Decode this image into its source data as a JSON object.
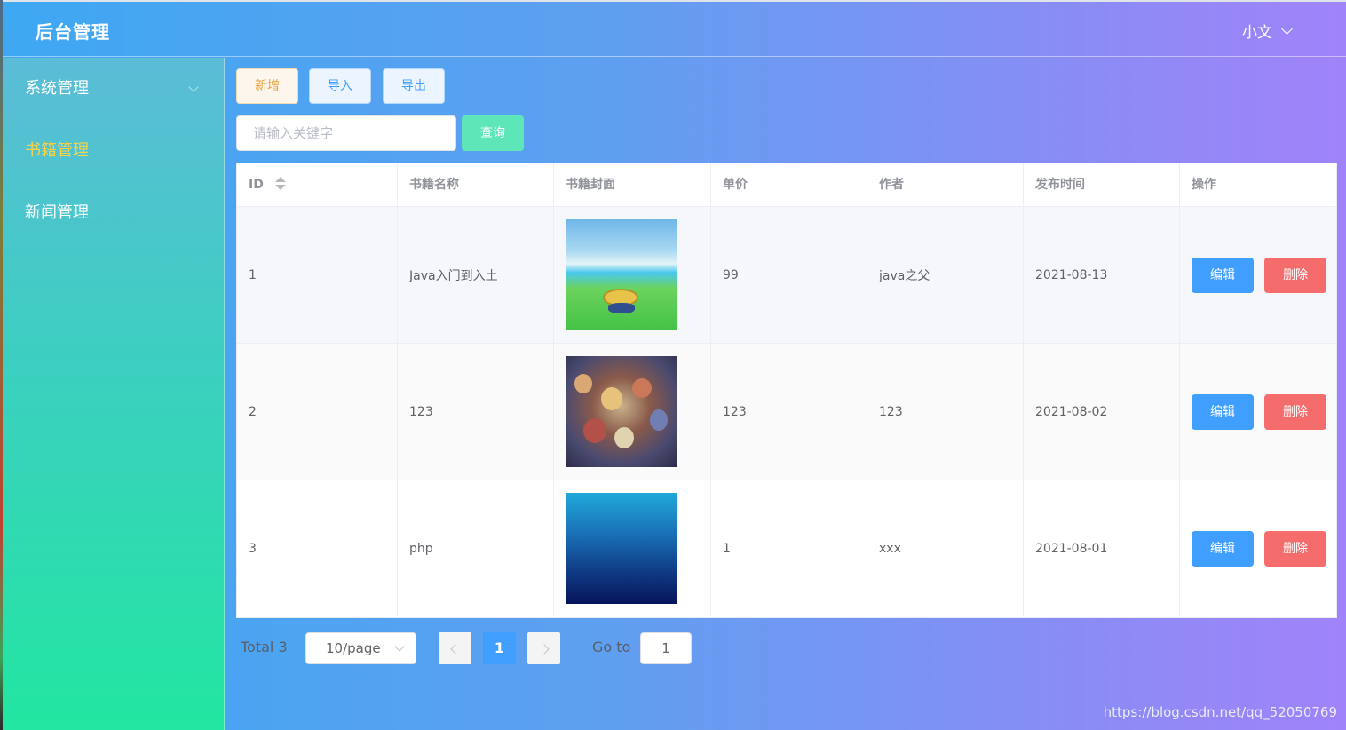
{
  "header": {
    "brand": "后台管理",
    "user": "小文"
  },
  "sidebar": {
    "items": [
      {
        "label": "系统管理",
        "has_submenu": true
      },
      {
        "label": "书籍管理",
        "active": true
      },
      {
        "label": "新闻管理"
      }
    ]
  },
  "toolbar": {
    "add_label": "新增",
    "import_label": "导入",
    "export_label": "导出"
  },
  "search": {
    "placeholder": "请输入关键字",
    "value": "",
    "query_label": "查询"
  },
  "table": {
    "columns": [
      "ID",
      "书籍名称",
      "书籍封面",
      "单价",
      "作者",
      "发布时间",
      "操作"
    ],
    "rows": [
      {
        "id": "1",
        "name": "Java入门到入土",
        "price": "99",
        "author": "java之父",
        "date": "2021-08-13",
        "edit": "编辑",
        "delete": "删除"
      },
      {
        "id": "2",
        "name": "123",
        "price": "123",
        "author": "123",
        "date": "2021-08-02",
        "edit": "编辑",
        "delete": "删除"
      },
      {
        "id": "3",
        "name": "php",
        "price": "1",
        "author": "xxx",
        "date": "2021-08-01",
        "edit": "编辑",
        "delete": "删除"
      }
    ]
  },
  "pagination": {
    "total": "Total 3",
    "page_size": "10/page",
    "current": "1",
    "goto_label": "Go to",
    "goto_value": "1"
  },
  "watermark": "https://blog.csdn.net/qq_52050769",
  "colors": {
    "primary": "#409eff",
    "danger": "#f56c6c",
    "warning": "#e6a23c",
    "success_light": "#5fe6b8",
    "active_menu": "#f7d34a"
  }
}
